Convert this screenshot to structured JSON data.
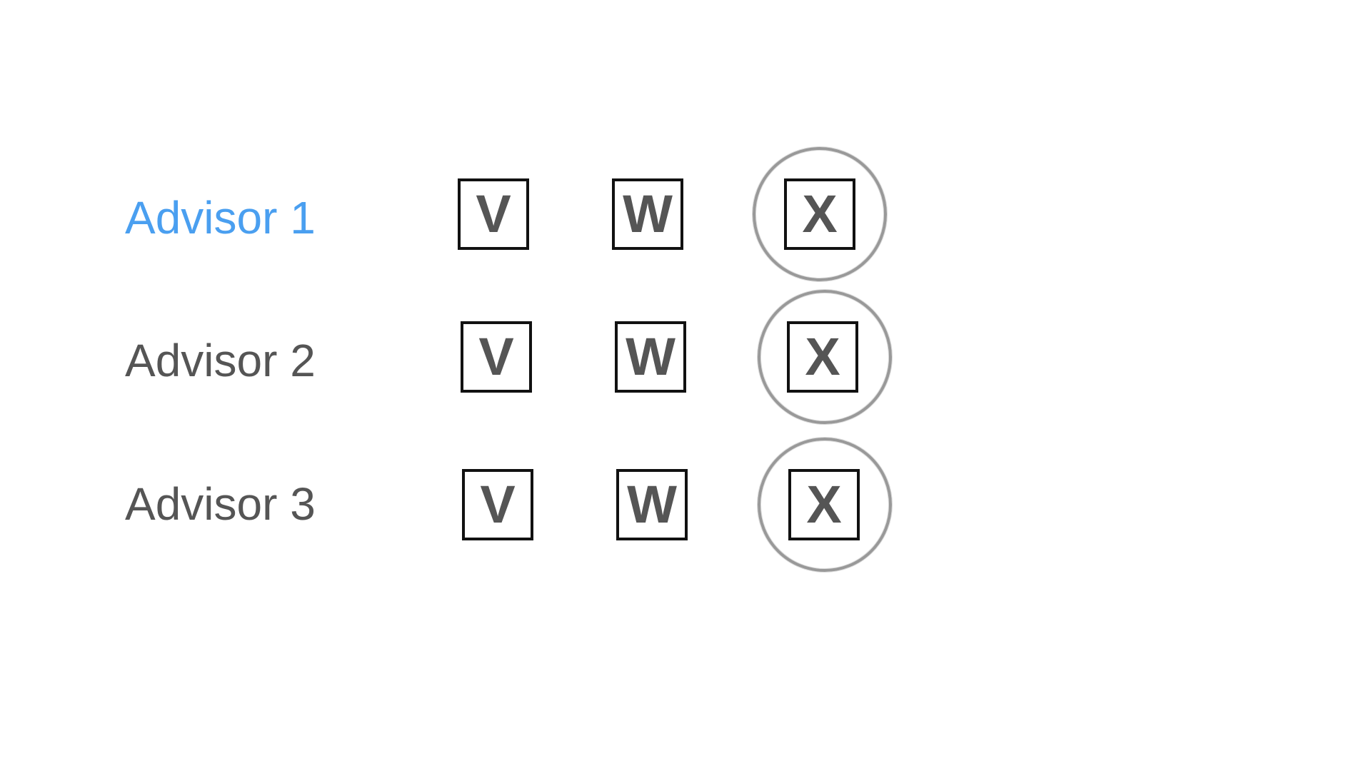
{
  "rows": [
    {
      "label": "Advisor 1",
      "active": true,
      "options": [
        "V",
        "W",
        "X"
      ],
      "selected": "X"
    },
    {
      "label": "Advisor 2",
      "active": false,
      "options": [
        "V",
        "W",
        "X"
      ],
      "selected": "X"
    },
    {
      "label": "Advisor 3",
      "active": false,
      "options": [
        "V",
        "W",
        "X"
      ],
      "selected": "X"
    }
  ],
  "colors": {
    "active_label": "#4a9ff0",
    "label": "#555555",
    "box_border": "#111111",
    "ring": "#999999"
  }
}
